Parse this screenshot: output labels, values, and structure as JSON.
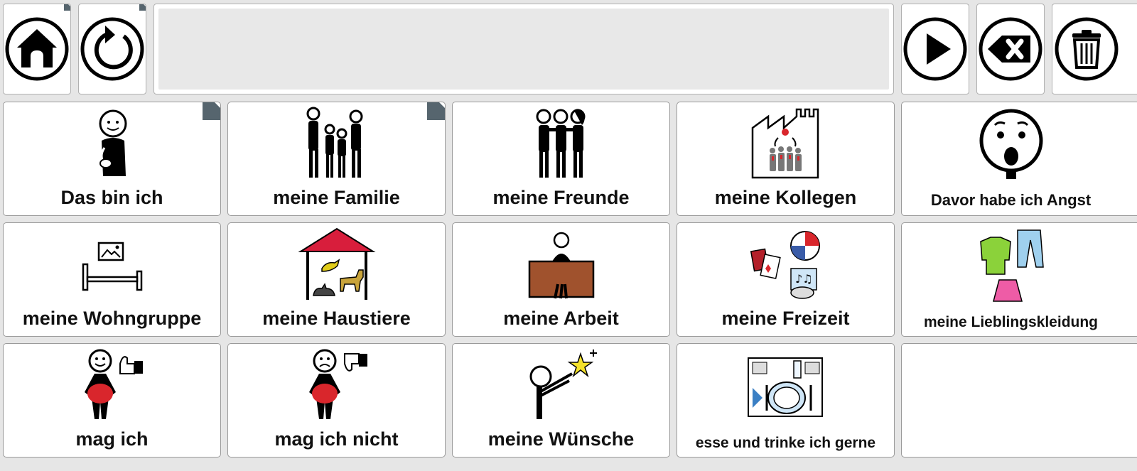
{
  "toolbar": {
    "left_buttons": [
      {
        "id": "home",
        "icon": "home-icon"
      },
      {
        "id": "back",
        "icon": "back-icon"
      }
    ],
    "message_bar": {
      "text": ""
    },
    "right_buttons": [
      {
        "id": "speak",
        "icon": "play-icon"
      },
      {
        "id": "backspace",
        "icon": "backspace-icon"
      },
      {
        "id": "clear",
        "icon": "trash-icon"
      }
    ]
  },
  "grid": {
    "rows": [
      [
        {
          "label": "Das bin ich",
          "icon": "self-person-icon",
          "folder": true
        },
        {
          "label": "meine Familie",
          "icon": "family-icon",
          "folder": true
        },
        {
          "label": "meine Freunde",
          "icon": "friends-icon",
          "folder": false
        },
        {
          "label": "meine Kollegen",
          "icon": "colleagues-icon",
          "folder": false
        },
        {
          "label": "Davor habe ich Angst",
          "icon": "scared-face-icon",
          "folder": false
        }
      ],
      [
        {
          "label": "meine Wohngruppe",
          "icon": "bed-icon",
          "folder": false
        },
        {
          "label": "meine Haustiere",
          "icon": "pets-icon",
          "folder": false
        },
        {
          "label": "meine Arbeit",
          "icon": "work-desk-icon",
          "folder": false
        },
        {
          "label": "meine Freizeit",
          "icon": "leisure-icon",
          "folder": false
        },
        {
          "label": "meine Lieblingskleidung",
          "icon": "clothes-icon",
          "folder": false
        }
      ],
      [
        {
          "label": "mag ich",
          "icon": "like-icon",
          "folder": false
        },
        {
          "label": "mag ich nicht",
          "icon": "dislike-icon",
          "folder": false
        },
        {
          "label": "meine Wünsche",
          "icon": "wish-star-icon",
          "folder": false
        },
        {
          "label": "esse und trinke ich gerne",
          "icon": "food-plate-icon",
          "folder": false
        },
        {
          "label": "",
          "icon": "",
          "folder": false
        }
      ]
    ]
  },
  "colors": {
    "background": "#e6e6e6",
    "folder_marker": "#56656e",
    "accent_red": "#d9262c",
    "roof_red": "#d81e3c"
  }
}
